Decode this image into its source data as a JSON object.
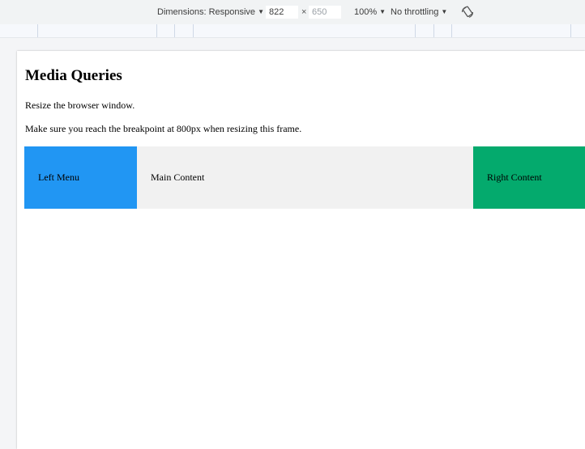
{
  "toolbar": {
    "dimensions_label": "Dimensions: Responsive",
    "width_value": "822",
    "times_symbol": "×",
    "height_value": "650",
    "zoom_label": "100%",
    "throttling_label": "No throttling",
    "rotate_icon": "rotate-icon"
  },
  "page": {
    "title": "Media Queries",
    "para1": "Resize the browser window.",
    "para2": "Make sure you reach the breakpoint at 800px when resizing this frame."
  },
  "columns": [
    {
      "label": "Left Menu",
      "color": "#2196f3"
    },
    {
      "label": "Main Content",
      "color": "#f1f1f1"
    },
    {
      "label": "Right Content",
      "color": "#04aa6d"
    }
  ]
}
